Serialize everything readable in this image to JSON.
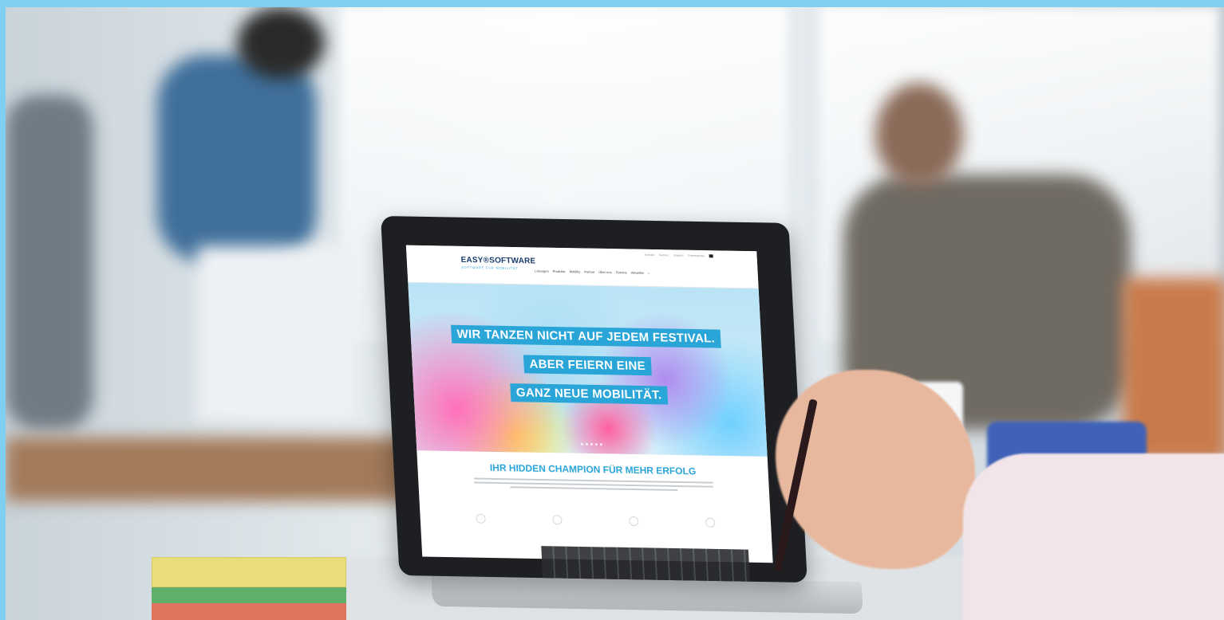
{
  "site": {
    "logo": "EASY®SOFTWARE",
    "tagline": "SOFTWARE FÜR MOBILITÄT",
    "topbar": [
      "Kontakt",
      "Karriere",
      "Support",
      "Partnerportal"
    ],
    "nav": [
      "Lösungen",
      "Produkte",
      "Mobility",
      "Partner",
      "Über uns",
      "Termine",
      "Aktuelles"
    ],
    "headline_lines": [
      "WIR TANZEN NICHT AUF JEDEM FESTIVAL.",
      "ABER FEIERN EINE",
      "GANZ NEUE MOBILITÄT."
    ],
    "section_title": "IHR HIDDEN CHAMPION FÜR MEHR ERFOLG"
  },
  "colors": {
    "accent": "#2aa5d8",
    "frame": "#7fd0f0",
    "logo": "#1a3c6e"
  },
  "icons": [
    "search-icon",
    "flag-icon"
  ]
}
